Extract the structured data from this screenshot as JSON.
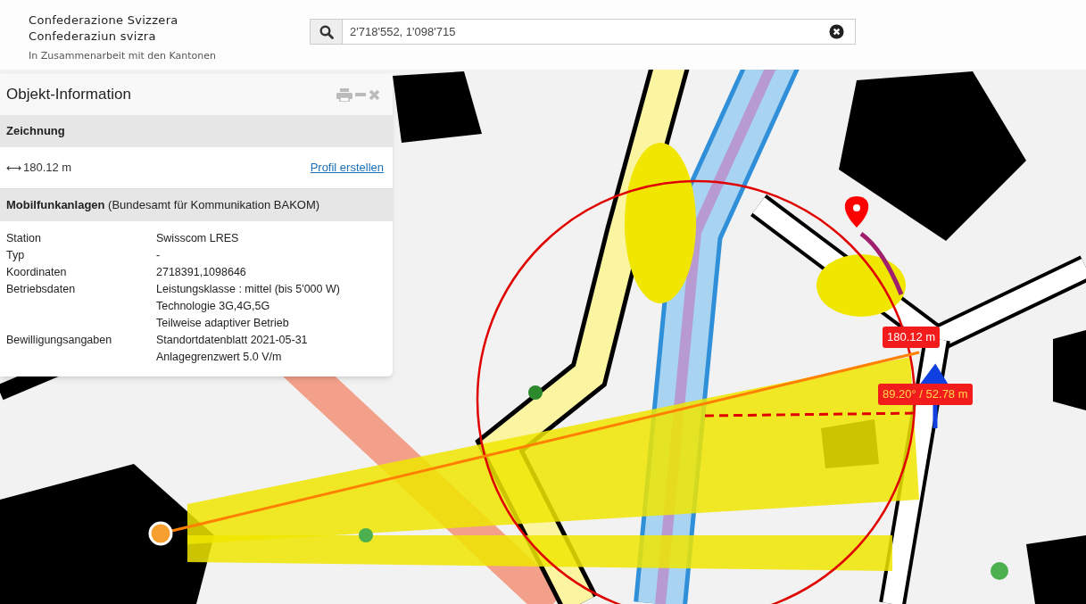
{
  "header": {
    "title_lines": [
      "Confederazione Svizzera",
      "Confederaziun svizra"
    ],
    "subtitle": "In Zusammenarbeit mit den Kantonen"
  },
  "search": {
    "value": "2'718'552, 1'098'715"
  },
  "panel": {
    "title": "Objekt-Information",
    "drawing_section": {
      "heading": "Zeichnung",
      "length_icon": "⟷",
      "length": "180.12 m",
      "link": "Profil erstellen"
    },
    "layer_section": {
      "heading": "**Mobilfunkanlagen** (Bundesamt für Kommunikation BAKOM)",
      "rows": [
        {
          "label": "Station",
          "values": [
            "Swisscom LRES"
          ]
        },
        {
          "label": "Typ",
          "values": [
            "-"
          ]
        },
        {
          "label": "Koordinaten",
          "values": [
            "2718391,1098646"
          ]
        },
        {
          "label": "Betriebsdaten",
          "values": [
            "Leistungsklasse : mittel (bis 5'000 W)",
            "Technologie 3G,4G,5G",
            "Teilweise adaptiver Betrieb"
          ]
        },
        {
          "label": "Bewilligungsangaben",
          "values": [
            "Standortdatenblatt 2021-05-31",
            "Anlagegrenzwert 5.0 V/m"
          ]
        }
      ]
    }
  },
  "map": {
    "measure_labels": [
      {
        "text": "180.12 m"
      },
      {
        "text": "89.20° / 52.78 m"
      }
    ]
  }
}
